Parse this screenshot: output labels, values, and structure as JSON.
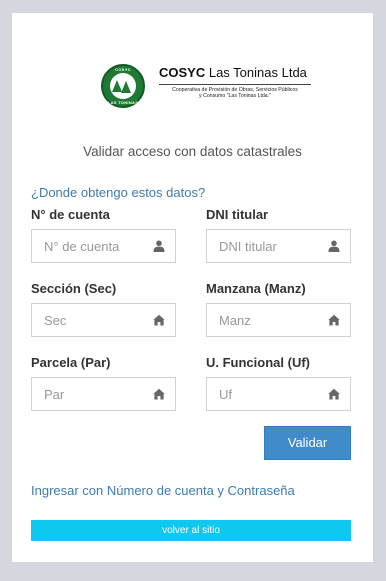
{
  "logo": {
    "name_bold": "COSYC",
    "name_light": " Las Toninas Ltda",
    "subline_1": "Cooperativa de Provisión de Obras, Servicios Públicos",
    "subline_2": "y Consumo \"Las Toninas Ltda.\"",
    "emblem_top": "COSYC",
    "emblem_bottom": "LAS TONINAS"
  },
  "subtitle": "Validar acceso con datos catastrales",
  "help_link": "¿Donde obtengo estos datos?",
  "fields": [
    {
      "label": "N° de cuenta",
      "placeholder": "N° de cuenta",
      "value": "",
      "icon": "user-icon"
    },
    {
      "label": "DNI titular",
      "placeholder": "DNI titular",
      "value": "",
      "icon": "user-icon"
    },
    {
      "label": "Sección (Sec)",
      "placeholder": "Sec",
      "value": "",
      "icon": "home-icon"
    },
    {
      "label": "Manzana (Manz)",
      "placeholder": "Manz",
      "value": "",
      "icon": "home-icon"
    },
    {
      "label": "Parcela (Par)",
      "placeholder": "Par",
      "value": "",
      "icon": "home-icon"
    },
    {
      "label": "U. Funcional (Uf)",
      "placeholder": "Uf",
      "value": "",
      "icon": "home-icon"
    }
  ],
  "validate_button": "Validar",
  "alt_login_link": "Ingresar con Número de cuenta y Contraseña",
  "back_button": "volver al sitio",
  "colors": {
    "background": "#d4d7de",
    "link": "#3f7bae",
    "primary_button": "#428bca",
    "back_button": "#0fc8f0",
    "logo_green": "#1f7a34"
  }
}
